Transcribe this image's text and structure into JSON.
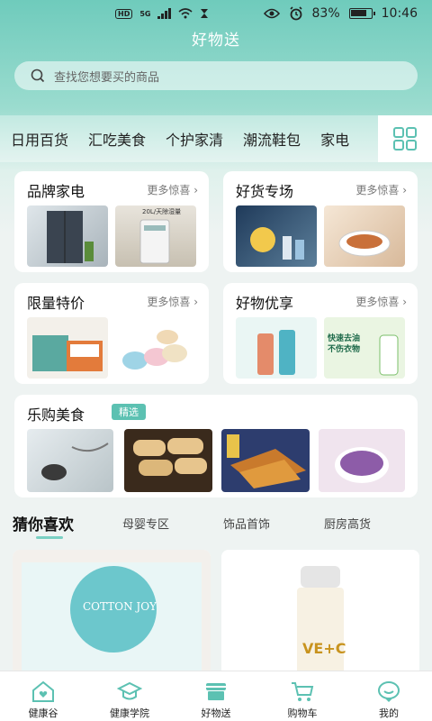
{
  "status": {
    "hd": "HD",
    "network": "5G",
    "battery": "83%",
    "battery_level": 0.83,
    "time": "10:46"
  },
  "header": {
    "title": "好物送"
  },
  "search": {
    "placeholder": "查找您想要买的商品"
  },
  "categories": [
    "日用百货",
    "汇吃美食",
    "个护家清",
    "潮流鞋包",
    "家电"
  ],
  "sections": {
    "brand_appliance": {
      "title": "品牌家电",
      "more": "更多惊喜",
      "img2_caption": "20L/天除湿量"
    },
    "good_goods": {
      "title": "好货专场",
      "more": "更多惊喜"
    },
    "limited": {
      "title": "限量特价",
      "more": "更多惊喜"
    },
    "good_things": {
      "title": "好物优享",
      "more": "更多惊喜",
      "img2_caption1": "快速去油",
      "img2_caption2": "不伤衣物"
    },
    "food": {
      "title": "乐购美食",
      "badge": "精选"
    }
  },
  "guess": {
    "title": "猜你喜欢",
    "tabs": [
      "母婴专区",
      "饰品首饰",
      "厨房高货"
    ]
  },
  "products": [
    {
      "label": "COTTON JOY"
    },
    {
      "label": "VE+C"
    }
  ],
  "tabbar": [
    {
      "label": "健康谷",
      "icon": "house-heart-icon"
    },
    {
      "label": "健康学院",
      "icon": "graduation-cap-icon"
    },
    {
      "label": "好物送",
      "icon": "gift-box-icon"
    },
    {
      "label": "购物车",
      "icon": "shopping-cart-icon"
    },
    {
      "label": "我的",
      "icon": "chat-face-icon"
    }
  ],
  "colors": {
    "accent": "#5cc1b2",
    "header_bg": "#6fcbbc"
  }
}
